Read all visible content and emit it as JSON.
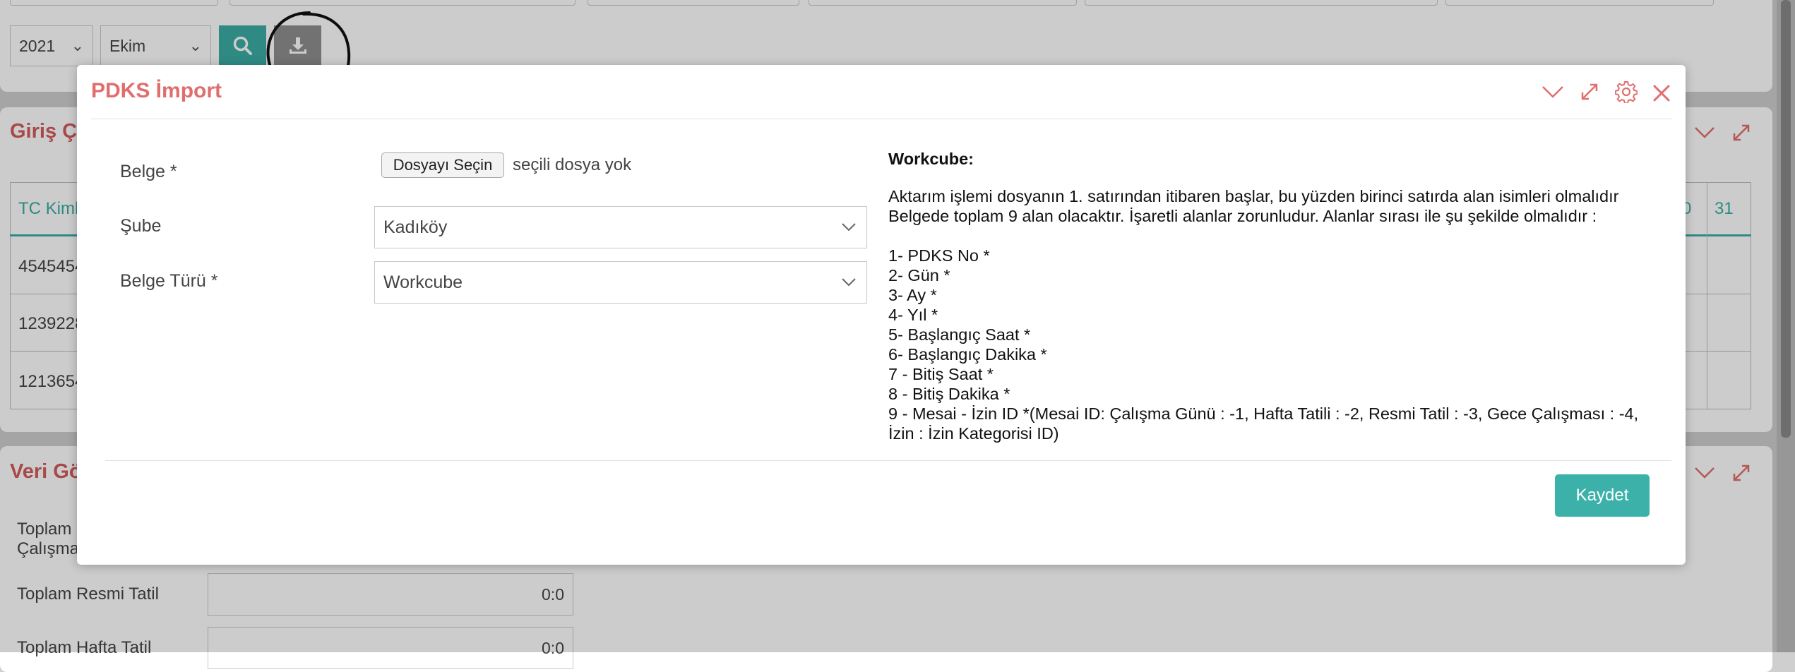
{
  "filters": {
    "year": "2021",
    "month": "Ekim"
  },
  "icons": {
    "search": "search-icon",
    "download": "download-icon",
    "collapse": "chevron-down-icon",
    "expand": "expand-icon",
    "settings": "gear-icon",
    "close": "close-icon"
  },
  "background": {
    "section1_title": "Giriş Ç",
    "table_header_first": "TC Kiml",
    "table_header_30": "0",
    "table_header_31": "31",
    "rows": [
      "4545454",
      "1239228",
      "1213654"
    ],
    "section2_title": "Veri Gö",
    "summary": [
      {
        "label": "Toplam",
        "label2": "Çalışma",
        "value": ""
      },
      {
        "label": "Toplam Resmi Tatil",
        "value": "0:0"
      },
      {
        "label": "Toplam Hafta Tatil",
        "value": "0:0"
      }
    ]
  },
  "modal": {
    "title": "PDKS İmport",
    "fields": {
      "belge_label": "Belge *",
      "file_button": "Dosyayı Seçin",
      "file_status": "seçili dosya yok",
      "sube_label": "Şube",
      "sube_value": "Kadıköy",
      "belge_turu_label": "Belge Türü *",
      "belge_turu_value": "Workcube"
    },
    "info": {
      "title": "Workcube:",
      "para1": "Aktarım işlemi dosyanın 1. satırından itibaren başlar, bu yüzden birinci satırda alan isimleri olmalıdır",
      "para2": "Belgede toplam 9 alan olacaktır. İşaretli alanlar zorunludur. Alanlar sırası ile şu şekilde olmalıdır :",
      "items": [
        "1- PDKS No *",
        "2- Gün *",
        "3- Ay *",
        "4- Yıl *",
        "5- Başlangıç Saat *",
        "6- Başlangıç Dakika *",
        "7 - Bitiş Saat *",
        "8 - Bitiş Dakika *",
        "9 - Mesai - İzin ID *(Mesai ID: Çalışma Günü : -1, Hafta Tatili : -2, Resmi Tatil : -3, Gece Çalışması : -4,",
        "İzin : İzin Kategorisi ID)"
      ]
    },
    "save_label": "Kaydet"
  },
  "colors": {
    "accent_red": "#e06e6e",
    "teal": "#3bada6"
  }
}
